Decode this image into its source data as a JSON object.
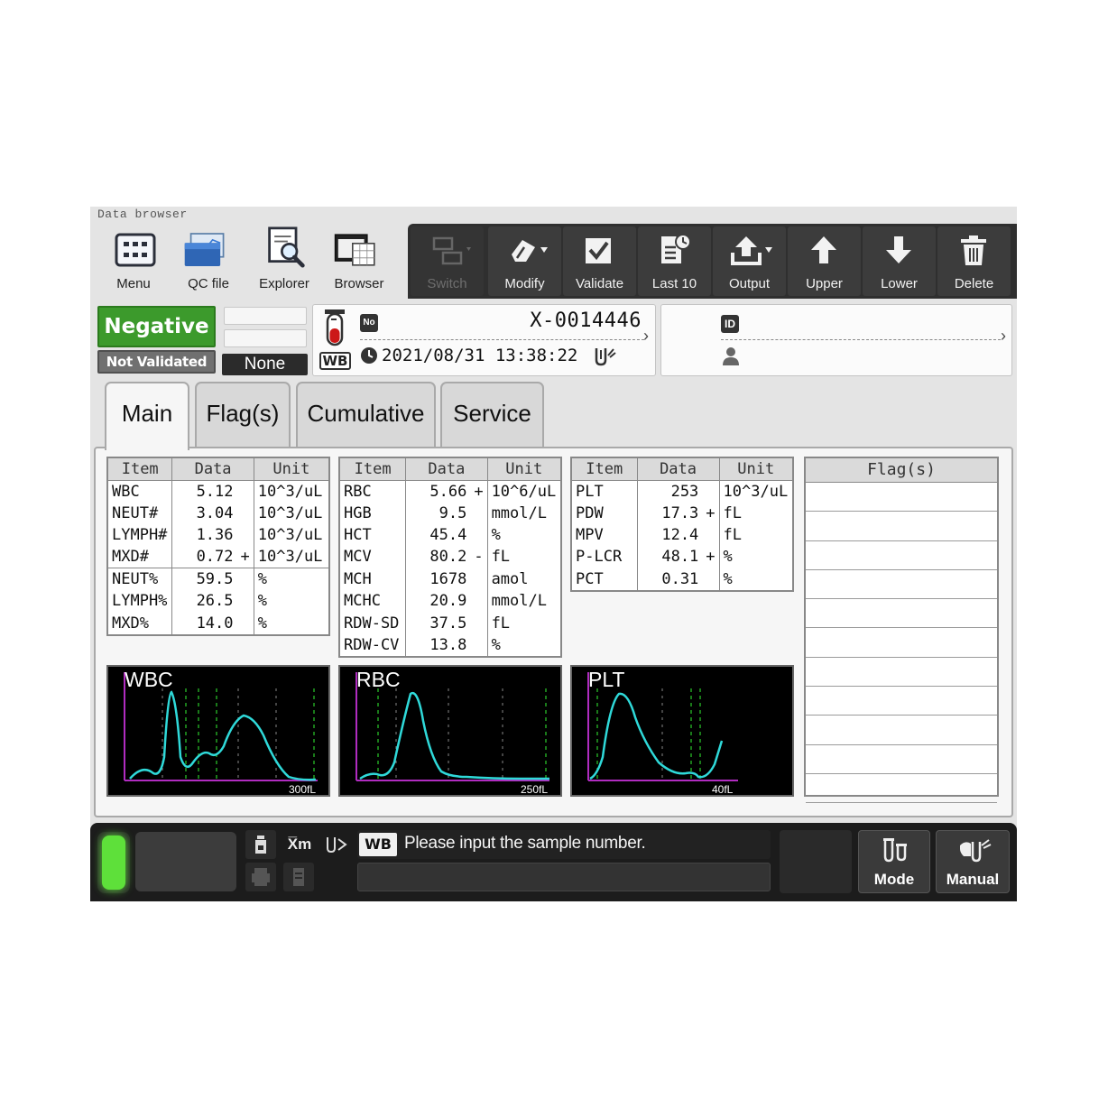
{
  "app_title": "Data browser",
  "toolbar_left": [
    {
      "label": "Menu",
      "icon": "menu-grid-icon"
    },
    {
      "label": "QC file",
      "icon": "qc-file-icon"
    },
    {
      "label": "Explorer",
      "icon": "explorer-icon"
    },
    {
      "label": "Browser",
      "icon": "browser-icon"
    }
  ],
  "toolbar_right": [
    {
      "label": "Switch",
      "icon": "switch-icon",
      "disabled": true
    },
    {
      "label": "Modify",
      "icon": "modify-icon"
    },
    {
      "label": "Validate",
      "icon": "checkbox-icon"
    },
    {
      "label": "Last 10",
      "icon": "last10-icon"
    },
    {
      "label": "Output",
      "icon": "upload-icon"
    },
    {
      "label": "Upper",
      "icon": "arrow-up-icon"
    },
    {
      "label": "Lower",
      "icon": "arrow-down-icon"
    },
    {
      "label": "Delete",
      "icon": "trash-icon"
    }
  ],
  "status": {
    "judgment": "Negative",
    "validation": "Not Validated",
    "none_label": "None"
  },
  "sample": {
    "mode": "WB",
    "no_badge": "No",
    "number": "X-0014446",
    "datetime": "2021/08/31 13:38:22"
  },
  "patient": {
    "id_badge": "ID",
    "id_value": ""
  },
  "tabs": [
    "Main",
    "Flag(s)",
    "Cumulative",
    "Service"
  ],
  "active_tab": "Main",
  "tables": [
    {
      "headers": [
        "Item",
        "Data",
        "Unit"
      ],
      "rows": [
        {
          "item": "WBC",
          "data": "5.12",
          "flag": "",
          "unit": "10^3/uL"
        },
        {
          "item": "NEUT#",
          "data": "3.04",
          "flag": "",
          "unit": "10^3/uL"
        },
        {
          "item": "LYMPH#",
          "data": "1.36",
          "flag": "",
          "unit": "10^3/uL"
        },
        {
          "item": "MXD#",
          "data": "0.72",
          "flag": "+",
          "unit": "10^3/uL"
        },
        {
          "item": "NEUT%",
          "data": "59.5",
          "flag": "",
          "unit": "%"
        },
        {
          "item": "LYMPH%",
          "data": "26.5",
          "flag": "",
          "unit": "%"
        },
        {
          "item": "MXD%",
          "data": "14.0",
          "flag": "",
          "unit": "%"
        }
      ]
    },
    {
      "headers": [
        "Item",
        "Data",
        "Unit"
      ],
      "rows": [
        {
          "item": "RBC",
          "data": "5.66",
          "flag": "+",
          "unit": "10^6/uL"
        },
        {
          "item": "HGB",
          "data": "9.5",
          "flag": "",
          "unit": "mmol/L"
        },
        {
          "item": "HCT",
          "data": "45.4",
          "flag": "",
          "unit": "%"
        },
        {
          "item": "MCV",
          "data": "80.2",
          "flag": "-",
          "unit": "fL"
        },
        {
          "item": "MCH",
          "data": "1678",
          "flag": "",
          "unit": "amol"
        },
        {
          "item": "MCHC",
          "data": "20.9",
          "flag": "",
          "unit": "mmol/L"
        },
        {
          "item": "RDW-SD",
          "data": "37.5",
          "flag": "",
          "unit": "fL"
        },
        {
          "item": "RDW-CV",
          "data": "13.8",
          "flag": "",
          "unit": "%"
        }
      ]
    },
    {
      "headers": [
        "Item",
        "Data",
        "Unit"
      ],
      "rows": [
        {
          "item": "PLT",
          "data": "253",
          "flag": "",
          "unit": "10^3/uL"
        },
        {
          "item": "PDW",
          "data": "17.3",
          "flag": "+",
          "unit": "fL"
        },
        {
          "item": "MPV",
          "data": "12.4",
          "flag": "",
          "unit": "fL"
        },
        {
          "item": "P-LCR",
          "data": "48.1",
          "flag": "+",
          "unit": "%"
        },
        {
          "item": "PCT",
          "data": "0.31",
          "flag": "",
          "unit": "%"
        }
      ]
    }
  ],
  "flags_header": "Flag(s)",
  "histograms": [
    {
      "title": "WBC",
      "max_label": "300fL",
      "color": "#2fd9d9"
    },
    {
      "title": "RBC",
      "max_label": "250fL",
      "color": "#2fd9d9"
    },
    {
      "title": "PLT",
      "max_label": "40fL",
      "color": "#2fd9d9"
    }
  ],
  "statusbar": {
    "mode_badge": "WB",
    "message": "Please input the sample number.",
    "xm_label": "X̅m",
    "mode_button": "Mode",
    "manual_button": "Manual"
  },
  "colors": {
    "negative_green": "#3c9a2c",
    "indicator_green": "#5ee03a",
    "toolbar_dark": "#2f2f2f"
  }
}
